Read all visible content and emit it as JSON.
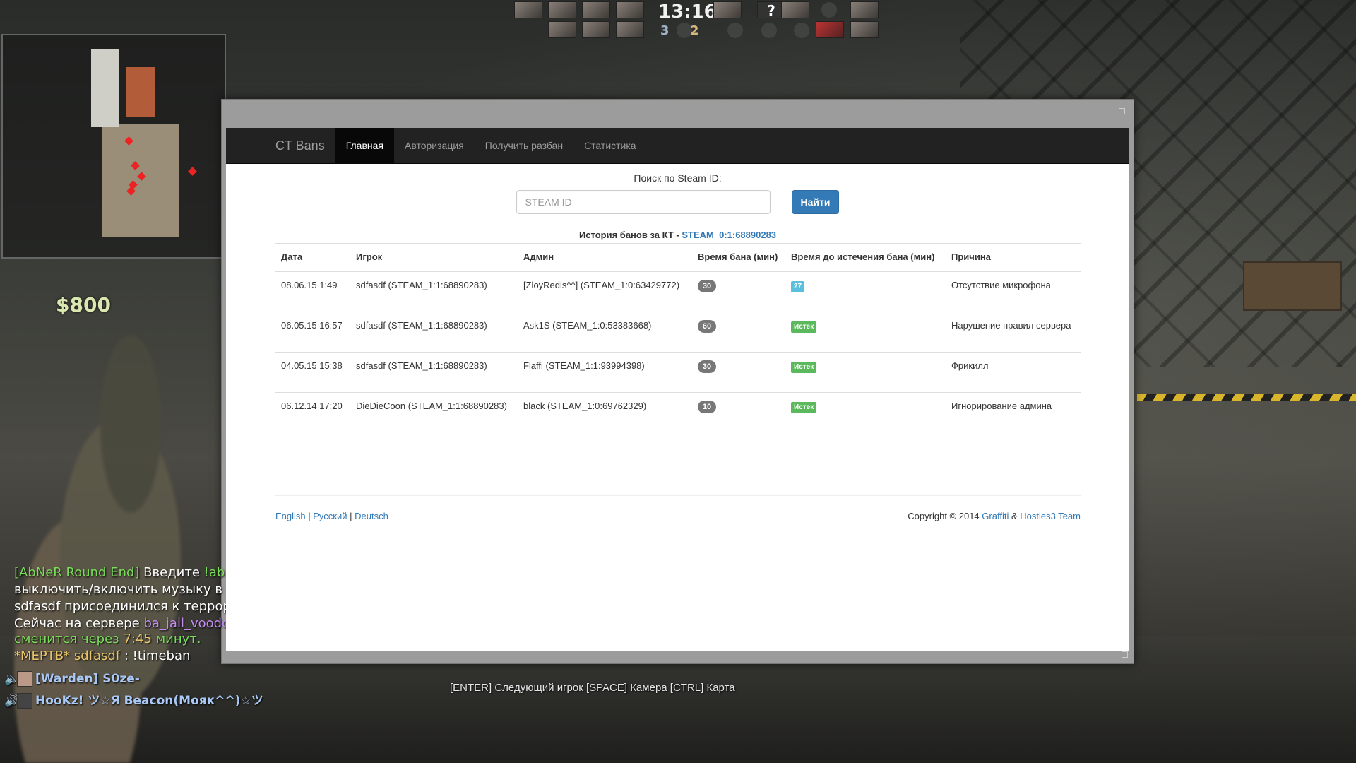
{
  "hud": {
    "clock": "13:16",
    "score_ct": "3",
    "score_t": "2",
    "unknown_player": "?",
    "money": "$800"
  },
  "window": {
    "navbar": {
      "brand": "CT Bans",
      "items": [
        {
          "label": "Главная",
          "active": true
        },
        {
          "label": "Авторизация",
          "active": false
        },
        {
          "label": "Получить разбан",
          "active": false
        },
        {
          "label": "Статистика",
          "active": false
        }
      ]
    },
    "search": {
      "label": "Поиск по Steam ID:",
      "placeholder": "STEAM ID",
      "value": "",
      "button": "Найти"
    },
    "history": {
      "prefix": "История банов за КТ - ",
      "steam_id": "STEAM_0:1:68890283"
    },
    "table": {
      "headers": [
        "Дата",
        "Игрок",
        "Админ",
        "Время бана (мин)",
        "Время до истечения бана (мин)",
        "Причина"
      ],
      "rows": [
        {
          "date": "08.06.15 1:49",
          "player": "sdfasdf (STEAM_1:1:68890283)",
          "admin": "[ZloyRedis^^] (STEAM_1:0:63429772)",
          "ban_time": "30",
          "expires": "27",
          "expires_status": "info",
          "reason": "Отсутствие микрофона"
        },
        {
          "date": "06.05.15 16:57",
          "player": "sdfasdf (STEAM_1:1:68890283)",
          "admin": "Ask1S (STEAM_1:0:53383668)",
          "ban_time": "60",
          "expires": "Истек",
          "expires_status": "success",
          "reason": "Нарушение правил сервера"
        },
        {
          "date": "04.05.15 15:38",
          "player": "sdfasdf (STEAM_1:1:68890283)",
          "admin": "Flaffi (STEAM_1:1:93994398)",
          "ban_time": "30",
          "expires": "Истек",
          "expires_status": "success",
          "reason": "Фрикилл"
        },
        {
          "date": "06.12.14 17:20",
          "player": "DieDieCoon (STEAM_1:1:68890283)",
          "admin": "black (STEAM_1:0:69762329)",
          "ban_time": "10",
          "expires": "Истек",
          "expires_status": "success",
          "reason": "Игнорирование админа"
        }
      ]
    },
    "footer": {
      "languages": [
        "English",
        "Русский",
        "Deutsch"
      ],
      "separator": " | ",
      "copyright_prefix": "Copyright © 2014 ",
      "credit_1": "Graffiti",
      "amp": " & ",
      "credit_2": "Hosties3 Team"
    }
  },
  "chat": {
    "lines": [
      {
        "parts": [
          {
            "text": "[AbNeR Round End] ",
            "color": "green"
          },
          {
            "text": "Введите ",
            "color": "white"
          },
          {
            "text": "!abr",
            "color": "green"
          }
        ]
      },
      {
        "parts": [
          {
            "text": "выключить/включить музыку в кон",
            "color": "white"
          }
        ]
      },
      {
        "parts": [
          {
            "text": "sdfasdf присоединился к террорис",
            "color": "white"
          }
        ]
      },
      {
        "parts": [
          {
            "text": "Сейчас на сервере ",
            "color": "white"
          },
          {
            "text": "ba_jail_voodoo",
            "color": "purple"
          }
        ]
      },
      {
        "parts": [
          {
            "text": "сменится через ",
            "color": "green"
          },
          {
            "text": "7:45",
            "color": "gold"
          },
          {
            "text": " минут.",
            "color": "green"
          }
        ]
      },
      {
        "parts": [
          {
            "text": "*МЕРТВ* sdfasdf",
            "color": "gold"
          },
          {
            "text": " : !timeban",
            "color": "white"
          }
        ]
      }
    ],
    "voice": [
      {
        "name": "[Warden] S0ze-"
      },
      {
        "name": "HooKz! ツ☆Я Beacon(Мояк^^)☆ツ"
      }
    ]
  },
  "hint": "[ENTER] Следующий игрок [SPACE] Камера [CTRL] Карта"
}
